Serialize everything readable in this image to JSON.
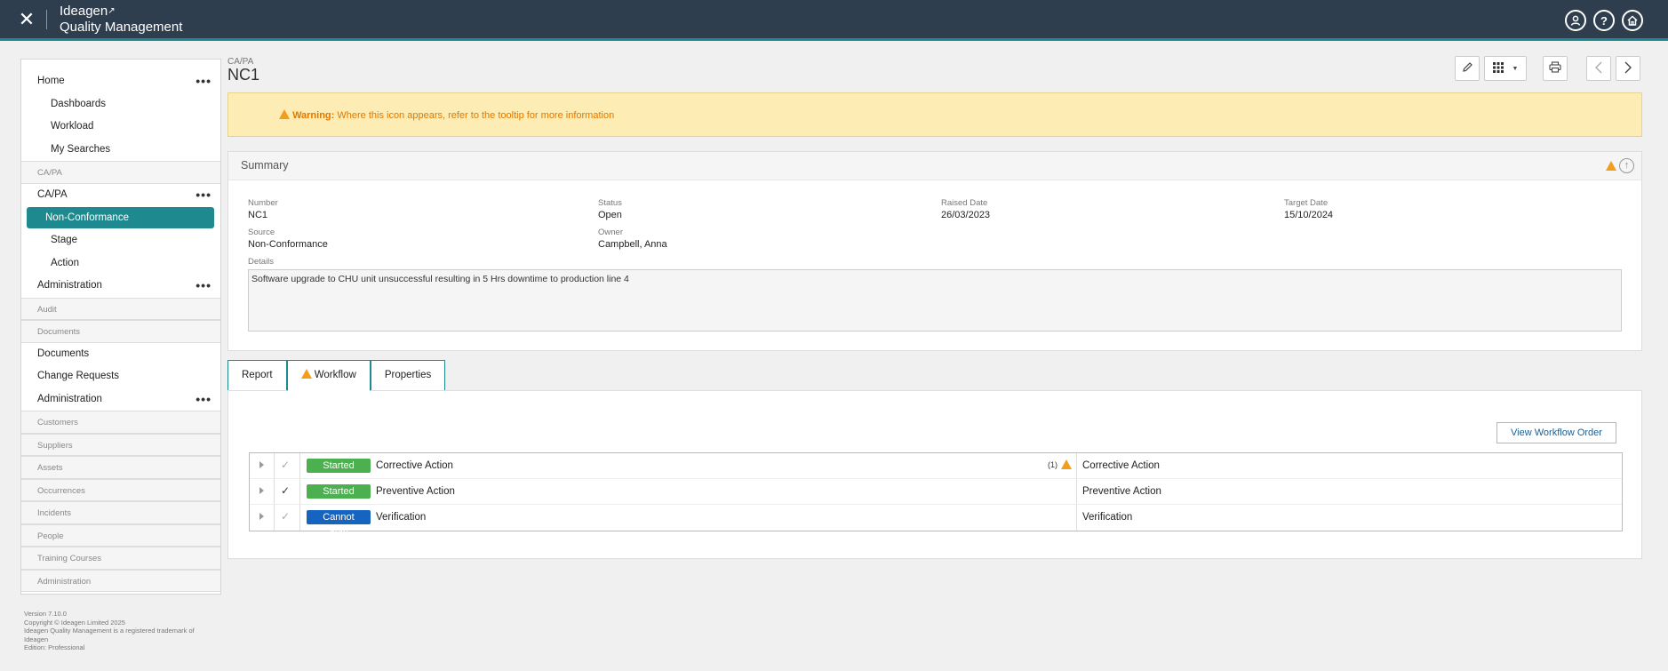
{
  "topbar": {
    "close": "✕",
    "brand_line1": "Ideagen",
    "brand_line2": "Quality Management",
    "icons": [
      "user-icon",
      "help-icon",
      "home-icon"
    ]
  },
  "sidebar": {
    "items": [
      {
        "label": "Home",
        "type": "top",
        "dots": "•••"
      },
      {
        "label": "Dashboards",
        "type": "sub"
      },
      {
        "label": "Workload",
        "type": "sub"
      },
      {
        "label": "My Searches",
        "type": "sub"
      },
      {
        "label": "CA/PA",
        "type": "group"
      },
      {
        "label": "CA/PA",
        "type": "top",
        "dots": "•••"
      },
      {
        "label": "Non-Conformance",
        "type": "active"
      },
      {
        "label": "Stage",
        "type": "sub"
      },
      {
        "label": "Action",
        "type": "sub"
      },
      {
        "label": "Administration",
        "type": "top",
        "dots": "•••"
      },
      {
        "label": "Audit",
        "type": "group"
      },
      {
        "label": "Documents",
        "type": "group"
      },
      {
        "label": "Documents",
        "type": "top"
      },
      {
        "label": "Change Requests",
        "type": "top"
      },
      {
        "label": "Administration",
        "type": "top",
        "dots": "•••"
      },
      {
        "label": "Customers",
        "type": "group"
      },
      {
        "label": "Suppliers",
        "type": "group"
      },
      {
        "label": "Assets",
        "type": "group"
      },
      {
        "label": "Occurrences",
        "type": "group"
      },
      {
        "label": "Incidents",
        "type": "group"
      },
      {
        "label": "People",
        "type": "group"
      },
      {
        "label": "Training Courses",
        "type": "group"
      },
      {
        "label": "Administration",
        "type": "group"
      }
    ],
    "footer": {
      "version": "Version 7.10.0",
      "copyright": "Copyright © Ideagen Limited 2025",
      "trademark": "Ideagen Quality Management is a registered trademark of Ideagen",
      "edition": "Edition: Professional"
    }
  },
  "header": {
    "crumb": "CA/PA",
    "title": "NC1"
  },
  "warning": {
    "bold": "Warning:",
    "text": " Where this icon appears, refer to the tooltip for more information"
  },
  "summary": {
    "title": "Summary",
    "fields": {
      "number_label": "Number",
      "number": "NC1",
      "status_label": "Status",
      "status": "Open",
      "raised_label": "Raised Date",
      "raised": "26/03/2023",
      "target_label": "Target Date",
      "target": "15/10/2024",
      "source_label": "Source",
      "source": "Non-Conformance",
      "owner_label": "Owner",
      "owner": "Campbell, Anna",
      "details_label": "Details",
      "details": "Software upgrade to CHU unit unsuccessful resulting in 5 Hrs downtime to production line 4"
    }
  },
  "tabs": {
    "report": "Report",
    "workflow": "Workflow",
    "properties": "Properties"
  },
  "workflow": {
    "view_order": "View Workflow Order",
    "rows": [
      {
        "status": "Started",
        "name": "Corrective Action",
        "count": "(1)",
        "right": "Corrective Action"
      },
      {
        "status": "Started",
        "name": "Preventive Action",
        "right": "Preventive Action"
      },
      {
        "status": "Cannot Start",
        "name": "Verification",
        "right": "Verification"
      }
    ]
  },
  "colors": {
    "topbar": "#2e3e4e",
    "accent": "#1e8a8f",
    "warning_bg": "#fdedb4",
    "warning_text": "#e07800",
    "badge_started": "#4caf50",
    "badge_cannot_start": "#1565c0"
  }
}
